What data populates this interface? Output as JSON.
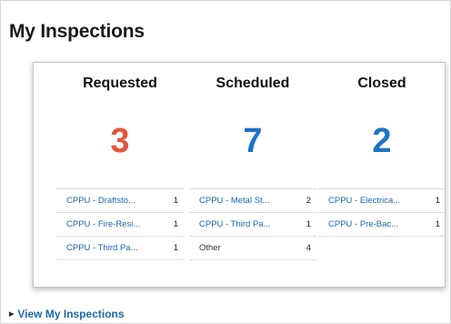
{
  "panel": {
    "title": "My Inspections"
  },
  "columns": [
    {
      "heading": "Requested",
      "count": "3",
      "color": "#e5553b",
      "rows": [
        {
          "label": "CPPU - Draftsto...",
          "count": "1"
        },
        {
          "label": "CPPU - Fire-Resi...",
          "count": "1"
        },
        {
          "label": "CPPU - Third Pa...",
          "count": "1"
        }
      ]
    },
    {
      "heading": "Scheduled",
      "count": "7",
      "color": "#1d73c4",
      "rows": [
        {
          "label": "CPPU - Metal St...",
          "count": "2"
        },
        {
          "label": "CPPU - Third Pa...",
          "count": "1"
        },
        {
          "label": "Other",
          "count": "4"
        }
      ]
    },
    {
      "heading": "Closed",
      "count": "2",
      "color": "#1d73c4",
      "rows": [
        {
          "label": "CPPU - Electrica...",
          "count": "1"
        },
        {
          "label": "CPPU - Pre-Bac...",
          "count": "1"
        }
      ]
    }
  ],
  "footer": {
    "link_label": "View My Inspections",
    "caret_icon": "caret-right-icon"
  }
}
